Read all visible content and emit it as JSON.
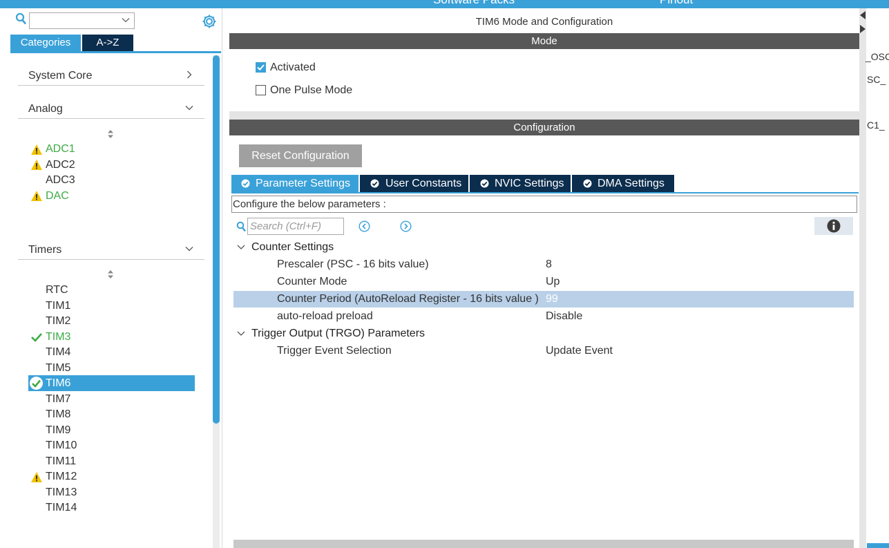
{
  "top_strip": {
    "left_text": "Software Packs",
    "right_text": "Pinout"
  },
  "left": {
    "search": {
      "value": ""
    },
    "tabs": {
      "categories": "Categories",
      "az": "A->Z"
    },
    "groups": {
      "system_core": "System Core",
      "analog": "Analog",
      "timers": "Timers"
    },
    "analog_items": [
      {
        "label": "ADC1",
        "status": "warning"
      },
      {
        "label": "ADC2",
        "status": "warning"
      },
      {
        "label": "ADC3",
        "status": "none"
      },
      {
        "label": "DAC",
        "status": "warning"
      }
    ],
    "timer_items": [
      {
        "label": "RTC",
        "status": "none"
      },
      {
        "label": "TIM1",
        "status": "none"
      },
      {
        "label": "TIM2",
        "status": "none"
      },
      {
        "label": "TIM3",
        "status": "ok"
      },
      {
        "label": "TIM4",
        "status": "none"
      },
      {
        "label": "TIM5",
        "status": "none"
      },
      {
        "label": "TIM6",
        "status": "selected"
      },
      {
        "label": "TIM7",
        "status": "none"
      },
      {
        "label": "TIM8",
        "status": "none"
      },
      {
        "label": "TIM9",
        "status": "none"
      },
      {
        "label": "TIM10",
        "status": "none"
      },
      {
        "label": "TIM11",
        "status": "none"
      },
      {
        "label": "TIM12",
        "status": "warning"
      },
      {
        "label": "TIM13",
        "status": "none"
      },
      {
        "label": "TIM14",
        "status": "none"
      }
    ]
  },
  "center": {
    "title": "TIM6 Mode and Configuration",
    "mode_header": "Mode",
    "mode": {
      "activated": {
        "label": "Activated",
        "checked": true
      },
      "one_pulse": {
        "label": "One Pulse Mode",
        "checked": false
      }
    },
    "config_header": "Configuration",
    "reset_button": "Reset Configuration",
    "tabs": [
      {
        "label": "Parameter Settings",
        "active": true
      },
      {
        "label": "User Constants",
        "active": false
      },
      {
        "label": "NVIC Settings",
        "active": false
      },
      {
        "label": "DMA Settings",
        "active": false
      }
    ],
    "note": "Configure the below parameters :",
    "search_placeholder": "Search (Ctrl+F)",
    "groups": [
      {
        "label": "Counter Settings",
        "params": [
          {
            "name": "Prescaler (PSC - 16 bits value)",
            "value": "8"
          },
          {
            "name": "Counter Mode",
            "value": "Up"
          },
          {
            "name": "Counter Period (AutoReload Register - 16 bits value )",
            "value": "99",
            "selected": true
          },
          {
            "name": "auto-reload preload",
            "value": "Disable"
          }
        ]
      },
      {
        "label": "Trigger Output (TRGO) Parameters",
        "params": [
          {
            "name": "Trigger Event Selection",
            "value": "Update Event"
          }
        ]
      }
    ]
  },
  "right": {
    "labels": [
      "_OSC",
      "SC_",
      "C1_"
    ]
  },
  "colors": {
    "accent": "#3aa1d8",
    "navy": "#0b2d4e",
    "section_bar": "#585858",
    "warning": "#f2c200",
    "ok": "#3daa45",
    "row_highlight": "#b9d0e8"
  }
}
